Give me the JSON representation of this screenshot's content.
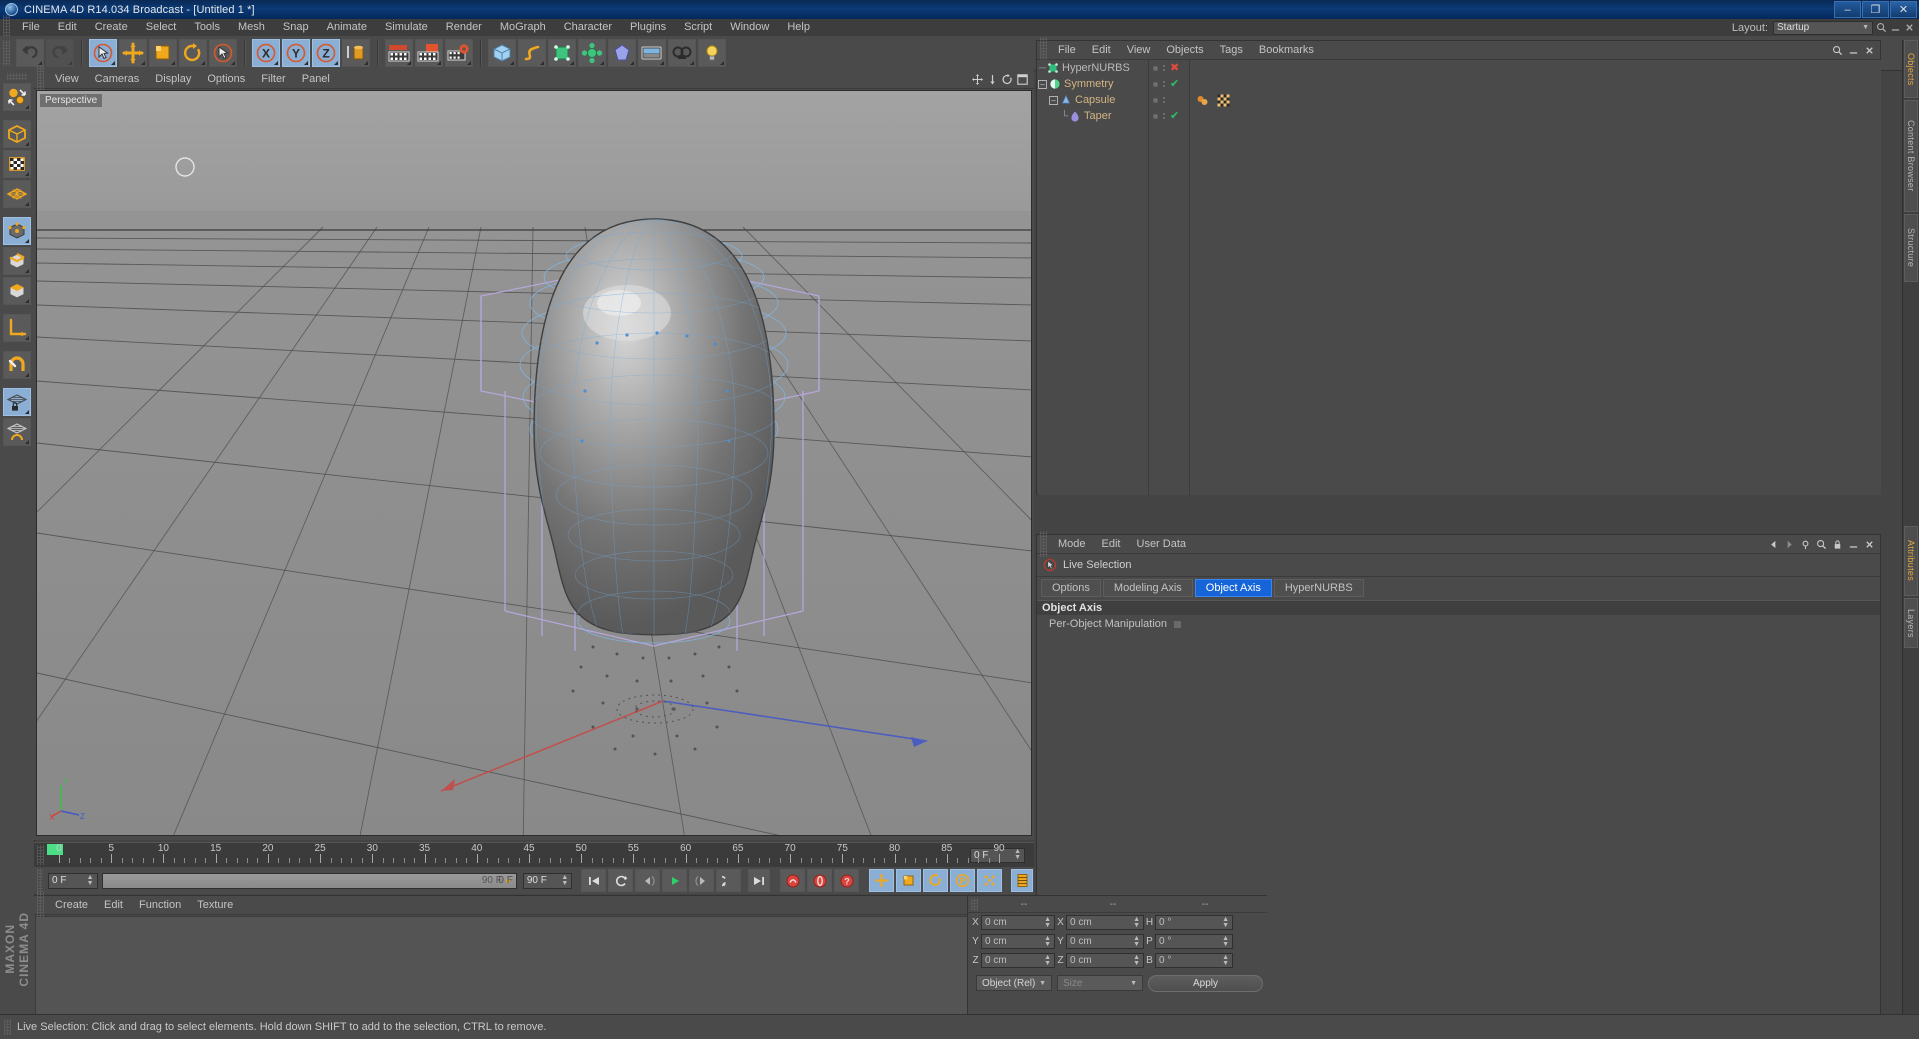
{
  "window": {
    "title": "CINEMA 4D R14.034 Broadcast - [Untitled 1 *]",
    "app_icon": "c4d-logo-icon",
    "minimize": "–",
    "maximize": "❐",
    "close": "✕"
  },
  "menubar": {
    "items": [
      "File",
      "Edit",
      "Create",
      "Select",
      "Tools",
      "Mesh",
      "Snap",
      "Animate",
      "Simulate",
      "Render",
      "MoGraph",
      "Character",
      "Plugins",
      "Script",
      "Window",
      "Help"
    ],
    "layout_label": "Layout:",
    "layout_value": "Startup",
    "search_icon": "search-icon",
    "minimize_icon": "minimize-icon",
    "close_icon": "close-icon"
  },
  "toolbar": {
    "groups": [
      {
        "name": "history",
        "buttons": [
          {
            "name": "undo-button",
            "icon": "undo-arrow-icon",
            "state": "normal"
          },
          {
            "name": "redo-button",
            "icon": "redo-arrow-icon",
            "state": "dim"
          }
        ]
      },
      {
        "name": "transform",
        "buttons": [
          {
            "name": "live-selection-button",
            "icon": "selection-arrow-icon",
            "state": "selected"
          },
          {
            "name": "move-button",
            "icon": "move-cross-icon",
            "state": "normal"
          },
          {
            "name": "scale-button",
            "icon": "scale-box-icon",
            "state": "normal"
          },
          {
            "name": "rotate-button",
            "icon": "rotate-ring-icon",
            "state": "normal"
          },
          {
            "name": "last-used-tool-button",
            "icon": "selection-arrow-icon",
            "state": "normal"
          }
        ]
      },
      {
        "name": "axis-locks",
        "buttons": [
          {
            "name": "lock-x-axis-button",
            "icon": "x-axis-icon",
            "state": "selected",
            "label": "X"
          },
          {
            "name": "lock-y-axis-button",
            "icon": "y-axis-icon",
            "state": "selected",
            "label": "Y"
          },
          {
            "name": "lock-z-axis-button",
            "icon": "z-axis-icon",
            "state": "selected",
            "label": "Z"
          },
          {
            "name": "world-object-coordinates-button",
            "icon": "world-coordinate-icon",
            "state": "normal"
          }
        ]
      },
      {
        "name": "render",
        "buttons": [
          {
            "name": "render-view-button",
            "icon": "render-clapper-icon",
            "state": "normal"
          },
          {
            "name": "render-to-picture-viewer-button",
            "icon": "render-picture-icon",
            "state": "normal"
          },
          {
            "name": "render-settings-button",
            "icon": "render-settings-icon",
            "state": "normal"
          }
        ]
      },
      {
        "name": "objects",
        "buttons": [
          {
            "name": "add-cube-button",
            "icon": "cube-icon",
            "state": "normal"
          },
          {
            "name": "add-spline-button",
            "icon": "spline-icon",
            "state": "normal"
          },
          {
            "name": "add-nurbs-button",
            "icon": "nurbs-icon",
            "state": "normal"
          },
          {
            "name": "add-array-button",
            "icon": "array-icon",
            "state": "normal"
          },
          {
            "name": "add-deformer-button",
            "icon": "deformer-icon",
            "state": "normal"
          },
          {
            "name": "add-environment-button",
            "icon": "environment-icon",
            "state": "normal"
          },
          {
            "name": "add-camera-button",
            "icon": "camera-icon",
            "state": "normal"
          },
          {
            "name": "add-light-button",
            "icon": "light-bulb-icon",
            "state": "normal"
          }
        ]
      }
    ]
  },
  "left_palette": {
    "groups": [
      [
        {
          "name": "tool-undo-redo-view-button",
          "icon": "view-undo-icon",
          "state": "normal"
        }
      ],
      [
        {
          "name": "mode-model-button",
          "icon": "model-cube-icon",
          "state": "normal"
        },
        {
          "name": "mode-texture-button",
          "icon": "texture-checker-icon",
          "state": "normal"
        },
        {
          "name": "mode-workplane-button",
          "icon": "workplane-grid-icon",
          "state": "normal"
        }
      ],
      [
        {
          "name": "points-mode-button",
          "icon": "points-cube-icon",
          "state": "selected"
        },
        {
          "name": "edges-mode-button",
          "icon": "edges-cube-icon",
          "state": "normal"
        },
        {
          "name": "polygons-mode-button",
          "icon": "polygons-cube-icon",
          "state": "normal"
        }
      ],
      [
        {
          "name": "axis-mode-button",
          "icon": "axis-corner-icon",
          "state": "normal"
        }
      ],
      [
        {
          "name": "snap-magnet-button",
          "icon": "magnet-icon",
          "state": "normal"
        }
      ],
      [
        {
          "name": "lock-workplane-button",
          "icon": "workplane-lock-icon",
          "state": "selected"
        },
        {
          "name": "planar-workplane-button",
          "icon": "workplane-planar-icon",
          "state": "normal"
        }
      ]
    ],
    "brand_line1": "MAXON",
    "brand_line2": "CINEMA 4D"
  },
  "viewport": {
    "menu": [
      "View",
      "Cameras",
      "Display",
      "Options",
      "Filter",
      "Panel"
    ],
    "label": "Perspective",
    "corner_icons": [
      "pan-view-icon",
      "dolly-view-icon",
      "rotate-view-icon",
      "maximize-view-icon"
    ],
    "axis_labels": {
      "x": "X",
      "y": "Y",
      "z": "Z"
    },
    "bg_top": "#9e9e9e",
    "bg_bottom": "#8a8a8a",
    "wire_color": "#7fb8e8",
    "hypernurbs_cage_color": "#b9a8e0"
  },
  "objects_panel": {
    "menu": [
      "File",
      "Edit",
      "View",
      "Objects",
      "Tags",
      "Bookmarks"
    ],
    "right_icons": [
      "search-icon",
      "collapse-icon",
      "close-icon"
    ],
    "tree": [
      {
        "name": "HyperNURBS",
        "indent": 0,
        "expander": "none",
        "icon": "hypernurbs-icon",
        "icon_color": "#2fbd7e",
        "label_color": "#b9b9b9",
        "visible_dot": true,
        "enable": "x",
        "tags": []
      },
      {
        "name": "Symmetry",
        "indent": 0,
        "expander": "minus",
        "icon": "symmetry-icon",
        "icon_color": "#4fd68a",
        "label_color": "#d4b483",
        "visible_dot": true,
        "enable": "check",
        "tags": []
      },
      {
        "name": "Capsule",
        "indent": 1,
        "expander": "minus",
        "icon": "capsule-icon",
        "icon_color": "#8fb8e8",
        "label_color": "#d4b483",
        "visible_dot": true,
        "enable": "none",
        "tags": [
          "phong-tag-icon",
          "texture-tag-icon"
        ]
      },
      {
        "name": "Taper",
        "indent": 2,
        "expander": "none",
        "icon": "taper-icon",
        "icon_color": "#9b8fe0",
        "label_color": "#d4b483",
        "visible_dot": true,
        "enable": "check",
        "tags": []
      }
    ]
  },
  "attributes_panel": {
    "menu": [
      "Mode",
      "Edit",
      "User Data"
    ],
    "right_icons": [
      "prev-icon",
      "next-icon",
      "pin-icon",
      "search-icon",
      "lock-icon",
      "settings-icon",
      "close-icon"
    ],
    "tool_icon": "live-selection-icon",
    "tool_name": "Live Selection",
    "tabs": [
      {
        "label": "Options",
        "active": false
      },
      {
        "label": "Modeling Axis",
        "active": false
      },
      {
        "label": "Object Axis",
        "active": true
      },
      {
        "label": "HyperNURBS",
        "active": false
      }
    ],
    "section_title": "Object Axis",
    "rows": [
      {
        "label": "Per-Object Manipulation",
        "checkbox": true
      }
    ]
  },
  "timeline": {
    "ticks": [
      0,
      5,
      10,
      15,
      20,
      25,
      30,
      35,
      40,
      45,
      50,
      55,
      60,
      65,
      70,
      75,
      80,
      85,
      90
    ],
    "min": 0,
    "max": 90,
    "current_frame_marker": 0,
    "end_field": "0 F",
    "current_frame_field": "0 F",
    "slider_value": "0 F",
    "slider_end_label": "90 F",
    "range_end_field": "90 F",
    "transport": [
      {
        "name": "go-to-start-button",
        "icon": "skip-back-icon"
      },
      {
        "name": "play-backwards-button",
        "icon": "play-reverse-icon"
      },
      {
        "name": "previous-frame-button",
        "icon": "step-back-icon"
      },
      {
        "name": "play-forward-button",
        "icon": "play-icon"
      },
      {
        "name": "next-frame-button",
        "icon": "step-forward-icon"
      },
      {
        "name": "play-loop-button",
        "icon": "loop-icon"
      },
      {
        "name": "go-to-end-button",
        "icon": "skip-forward-icon"
      }
    ],
    "record": [
      {
        "name": "record-active-objects-button",
        "icon": "record-key-icon"
      },
      {
        "name": "autokeying-button",
        "icon": "autokey-icon"
      },
      {
        "name": "keyframe-selection-button",
        "icon": "key-select-icon"
      }
    ],
    "keying": [
      {
        "name": "position-key-button",
        "icon": "position-key-icon",
        "state": "selected"
      },
      {
        "name": "scale-key-button",
        "icon": "scale-key-icon",
        "state": "selected"
      },
      {
        "name": "rotation-key-button",
        "icon": "rotation-key-icon",
        "state": "selected"
      },
      {
        "name": "parameter-key-button",
        "icon": "param-key-icon",
        "state": "selected"
      },
      {
        "name": "point-level-animation-button",
        "icon": "pla-key-icon",
        "state": "selected"
      }
    ],
    "extra": [
      {
        "name": "timeline-mode-button",
        "icon": "timeline-strip-icon",
        "state": "selected"
      }
    ]
  },
  "material_manager": {
    "menu": [
      "Create",
      "Edit",
      "Function",
      "Texture"
    ],
    "materials": []
  },
  "coordinates": {
    "headers": [
      "--",
      "--",
      "--"
    ],
    "rows": [
      {
        "axis1": "X",
        "val1": "0 cm",
        "axis2": "X",
        "val2": "0 cm",
        "axis3": "H",
        "val3": "0 °"
      },
      {
        "axis1": "Y",
        "val1": "0 cm",
        "axis2": "Y",
        "val2": "0 cm",
        "axis3": "P",
        "val3": "0 °"
      },
      {
        "axis1": "Z",
        "val1": "0 cm",
        "axis2": "Z",
        "val2": "0 cm",
        "axis3": "B",
        "val3": "0 °"
      }
    ],
    "mode_select": "Object (Rel)",
    "size_select_placeholder": "Size",
    "apply_label": "Apply"
  },
  "side_tabs": {
    "upper": [
      {
        "label": "Objects",
        "active": true
      },
      {
        "label": "Content Browser",
        "active": false
      },
      {
        "label": "Structure",
        "active": false
      }
    ],
    "lower": [
      {
        "label": "Attributes",
        "active": true
      },
      {
        "label": "Layers",
        "active": false
      }
    ]
  },
  "status_bar": {
    "text": "Live Selection: Click and drag to select elements. Hold down SHIFT to add to the selection, CTRL to remove."
  }
}
